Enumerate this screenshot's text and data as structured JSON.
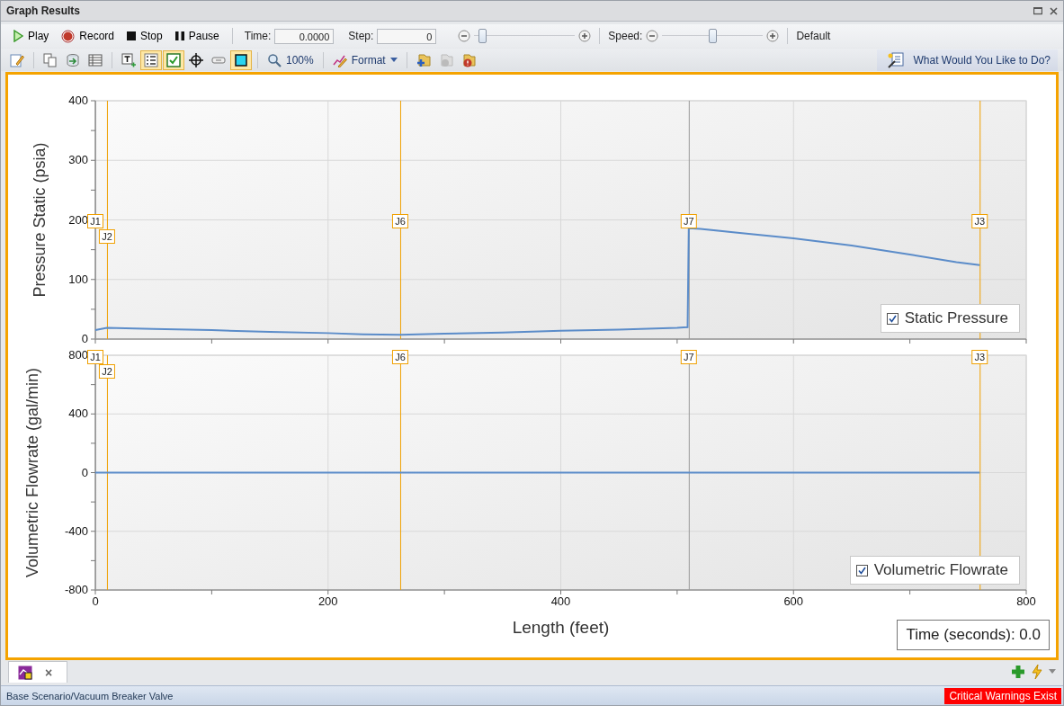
{
  "window": {
    "title": "Graph Results"
  },
  "playback": {
    "buttons": [
      {
        "kind": "play",
        "label": "Play"
      },
      {
        "kind": "record",
        "label": "Record"
      },
      {
        "kind": "stop",
        "label": "Stop"
      },
      {
        "kind": "pause",
        "label": "Pause"
      }
    ],
    "time": {
      "label": "Time:",
      "value": "0.0000"
    },
    "step": {
      "label": "Step:",
      "value": "0"
    },
    "zoom_slider": {
      "level": 0.05
    },
    "speed": {
      "label": "Speed:",
      "level": 0.5
    },
    "mode": "Default"
  },
  "toolbar": {
    "buttons": [
      {
        "kind": "edit",
        "selected": false
      },
      {
        "kind": "copy",
        "selected": false
      },
      {
        "kind": "export",
        "selected": false
      },
      {
        "kind": "table",
        "selected": false
      },
      {
        "kind": "text",
        "selected": false
      },
      {
        "kind": "legend",
        "selected": true
      },
      {
        "kind": "check",
        "selected": true
      },
      {
        "kind": "crosshair",
        "selected": false
      },
      {
        "kind": "ruler",
        "selected": false
      },
      {
        "kind": "frame",
        "selected": true
      },
      {
        "kind": "zoom",
        "label": "100%",
        "selected": false
      },
      {
        "kind": "format",
        "label": "Format",
        "selected": false
      },
      {
        "kind": "add-folder",
        "selected": false
      },
      {
        "kind": "disabled-folder",
        "selected": false
      },
      {
        "kind": "warning-folder",
        "selected": false
      }
    ],
    "help_button": "What Would You Like to Do?"
  },
  "graphs": [
    {
      "legend_checked": true,
      "chart_data": {
        "type": "line",
        "ylabel": "Pressure Static (psia)",
        "grid": true,
        "xlim": [
          0,
          800
        ],
        "ylim": [
          0,
          400
        ],
        "yticks": [
          0,
          100,
          200,
          300,
          400
        ],
        "x": [
          0,
          10,
          50,
          100,
          150,
          200,
          230,
          262,
          300,
          350,
          400,
          450,
          500,
          509,
          510,
          520,
          550,
          600,
          650,
          700,
          740,
          760
        ],
        "series": [
          {
            "name": "Static Pressure",
            "color": "#5b8cc9",
            "values": [
              15,
              19,
              17,
              15,
              12,
              10,
              8,
              7,
              9,
              11,
              14,
              16,
              19,
              20,
              186,
              185,
              179,
              169,
              157,
              142,
              129,
              124
            ]
          }
        ],
        "ref_lines": [
          {
            "axis": "x",
            "value": 0,
            "label": "J1",
            "color": "#9a9a9a"
          },
          {
            "axis": "x",
            "value": 10,
            "label": "J2",
            "color": "#f0a000"
          },
          {
            "axis": "x",
            "value": 262,
            "label": "J6",
            "color": "#f0a000"
          },
          {
            "axis": "x",
            "value": 510,
            "label": "J7",
            "color": "#9a9a9a"
          },
          {
            "axis": "x",
            "value": 760,
            "label": "J3",
            "color": "#f0a000"
          }
        ]
      }
    },
    {
      "legend_checked": true,
      "chart_data": {
        "type": "line",
        "xlabel": "Length (feet)",
        "ylabel": "Volumetric Flowrate (gal/min)",
        "grid": true,
        "xlim": [
          0,
          800
        ],
        "ylim": [
          -800,
          800
        ],
        "xticks": [
          0,
          200,
          400,
          600,
          800
        ],
        "yticks": [
          -800,
          -400,
          0,
          400,
          800
        ],
        "x": [
          0,
          760
        ],
        "series": [
          {
            "name": "Volumetric Flowrate",
            "color": "#5b8cc9",
            "values": [
              0,
              0
            ]
          }
        ],
        "ref_lines": [
          {
            "axis": "x",
            "value": 0,
            "label": "J1",
            "color": "#9a9a9a"
          },
          {
            "axis": "x",
            "value": 10,
            "label": "J2",
            "color": "#f0a000"
          },
          {
            "axis": "x",
            "value": 262,
            "label": "J6",
            "color": "#f0a000"
          },
          {
            "axis": "x",
            "value": 510,
            "label": "J7",
            "color": "#9a9a9a"
          },
          {
            "axis": "x",
            "value": 760,
            "label": "J3",
            "color": "#f0a000"
          }
        ]
      }
    }
  ],
  "time_label": "Time (seconds): 0.0",
  "tab": {
    "close": "×"
  },
  "status_bar": {
    "path": "Base Scenario/Vacuum Breaker Valve",
    "warning": "Critical Warnings Exist"
  }
}
